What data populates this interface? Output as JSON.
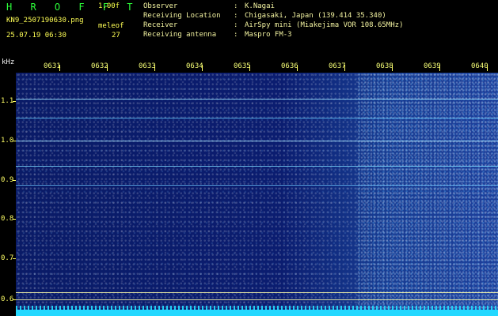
{
  "header": {
    "brand": "H R O F F T",
    "version": "1.00f",
    "filename": "KN9_2507190630.png",
    "meleof_label": "meleof",
    "datetime": "25.07.19 06:30",
    "count": "27",
    "metadata": [
      {
        "key": "Observer",
        "value": "K.Nagai"
      },
      {
        "key": "Receiving Location",
        "value": "Chigasaki, Japan (139.414 35.340)"
      },
      {
        "key": "Receiver",
        "value": "AirSpy mini (Miakejima VOR 108.65MHz)"
      },
      {
        "key": "Receiving antenna",
        "value": "Maspro FM-3"
      }
    ]
  },
  "axes": {
    "y_unit": "kHz",
    "y_labels": [
      "1.1",
      "1.0",
      "0.9",
      "0.8",
      "0.7",
      "0.6"
    ],
    "x_labels": [
      "0631",
      "0632",
      "0633",
      "0634",
      "0635",
      "0636",
      "0637",
      "0638",
      "0639",
      "0640"
    ]
  },
  "colors": {
    "background": "#000000",
    "spectrogram_dark": "#0a1b67",
    "spectrogram_light": "#1d3f9b",
    "header_text": "#ffff55",
    "brand_text": "#2cff3a",
    "axis": "#ffff66",
    "bottom_band": "#23d8ff"
  }
}
